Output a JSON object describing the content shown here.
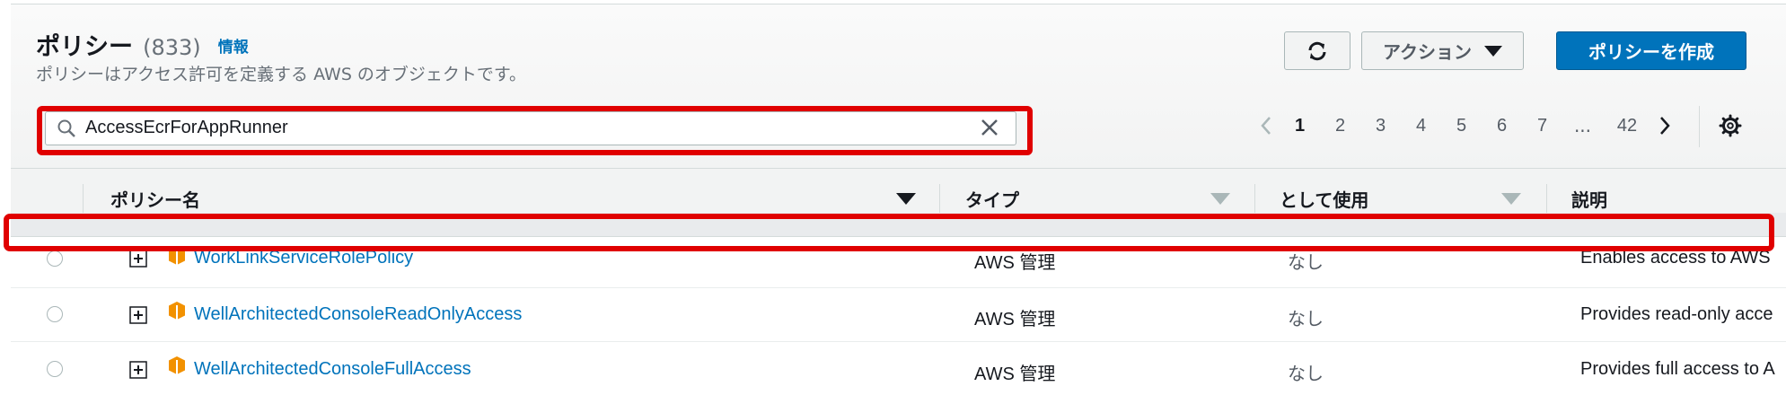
{
  "header": {
    "title": "ポリシー",
    "count": "(833)",
    "info_link": "情報",
    "subtitle": "ポリシーはアクセス許可を定義する AWS のオブジェクトです。"
  },
  "toolbar": {
    "refresh_icon": "refresh-icon",
    "actions_label": "アクション",
    "create_label": "ポリシーを作成"
  },
  "search": {
    "value": "AccessEcrForAppRunner",
    "search_icon": "search-icon",
    "clear_icon": "close-icon"
  },
  "pagination": {
    "pages": [
      "1",
      "2",
      "3",
      "4",
      "5",
      "6",
      "7"
    ],
    "ellipsis": "...",
    "last_page": "42",
    "current": "1"
  },
  "table": {
    "columns": [
      "ポリシー名",
      "タイプ",
      "として使用",
      "説明"
    ],
    "rows": [
      {
        "name": "WorkLinkServiceRolePolicy",
        "type": "AWS 管理",
        "used_as": "なし",
        "description": "Enables access to AWS"
      },
      {
        "name": "WellArchitectedConsoleReadOnlyAccess",
        "type": "AWS 管理",
        "used_as": "なし",
        "description": "Provides read-only acce"
      },
      {
        "name": "WellArchitectedConsoleFullAccess",
        "type": "AWS 管理",
        "used_as": "なし",
        "description": "Provides full access to A"
      }
    ]
  },
  "colors": {
    "accent": "#0073bb",
    "highlight": "#e00000",
    "aws_icon": "#f29100"
  }
}
